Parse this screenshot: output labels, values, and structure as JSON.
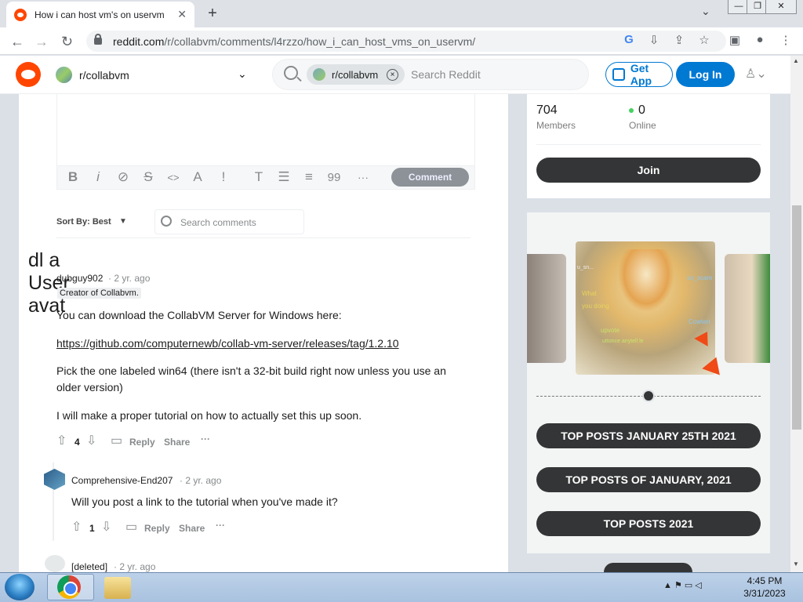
{
  "browser": {
    "tab_title": "How i can host vm's on uservm",
    "tab_close": "✕",
    "new_tab": "+",
    "tab_dropdown": "⌄",
    "window_buttons": [
      "—",
      "❐",
      "✕"
    ],
    "url_host": "reddit.com",
    "url_path": "/r/collabvm/comments/l4rzzo/how_i_can_host_vms_on_uservm/",
    "nav": {
      "back": "←",
      "forward": "→",
      "reload": "↻"
    },
    "toolbar_icons": [
      "G",
      "⇩",
      "⇪",
      "☆",
      "▣",
      "●",
      "⋮"
    ]
  },
  "reddit_header": {
    "subreddit": "r/collabvm",
    "dropdown": "⌄",
    "search_chip": "r/collabvm",
    "search_chip_close": "×",
    "search_placeholder": "Search Reddit",
    "get_app": "Get App",
    "login": "Log In",
    "user_menu": "♙⌄"
  },
  "editor": {
    "format_icons": [
      "B",
      "i",
      "⊘",
      "S",
      "<>",
      "A",
      "!",
      "T",
      "☰",
      "≡",
      "99",
      "···"
    ],
    "comment_button": "Comment"
  },
  "comments_bar": {
    "sort_label": "Sort By: Best",
    "sort_caret": "▼",
    "search_placeholder": "Search comments"
  },
  "comments": [
    {
      "broken_avatar_alt": "dl a User avat",
      "author": "dubguy902",
      "time": "· 2 yr. ago",
      "flair": "Creator of Collabvm.",
      "paragraphs": [
        "You can download the CollabVM Server for Windows here:",
        "https://github.com/computernewb/collab-vm-server/releases/tag/1.2.10",
        "Pick the one labeled win64 (there isn't a 32-bit build right now unless you use an older version)",
        "I will make a proper tutorial on how to actually set this up soon."
      ],
      "votes": "4",
      "reply": "Reply",
      "share": "Share",
      "more": "···"
    },
    {
      "author": "Comprehensive-End207",
      "time": "· 2 yr. ago",
      "paragraphs": [
        "Will you post a link to the tutorial when you've made it?"
      ],
      "votes": "1",
      "reply": "Reply",
      "share": "Share",
      "more": "···"
    },
    {
      "author": "[deleted]",
      "time": "· 2 yr. ago"
    }
  ],
  "sidebar": {
    "members_count": "704",
    "members_label": "Members",
    "online_count": "0",
    "online_label": "Online",
    "join": "Join",
    "image_text": [
      "What",
      "you doing",
      "so_scare",
      "Cowterr",
      "upvote",
      "uttonce anytell le",
      "u_sn..."
    ],
    "buttons": [
      "TOP POSTS JANUARY 25TH 2021",
      "TOP POSTS OF JANUARY, 2021",
      "TOP POSTS 2021"
    ]
  },
  "scrollbar": {
    "up": "▲",
    "down": "▼"
  },
  "taskbar": {
    "tray_icons": "▲ ⚑ ▭ ◁",
    "time": "4:45 PM",
    "date": "3/31/2023"
  },
  "colors": {
    "reddit_orange": "#ff4500",
    "reddit_blue": "#0079d3",
    "dark_button": "#343536",
    "online_green": "#46d160"
  }
}
